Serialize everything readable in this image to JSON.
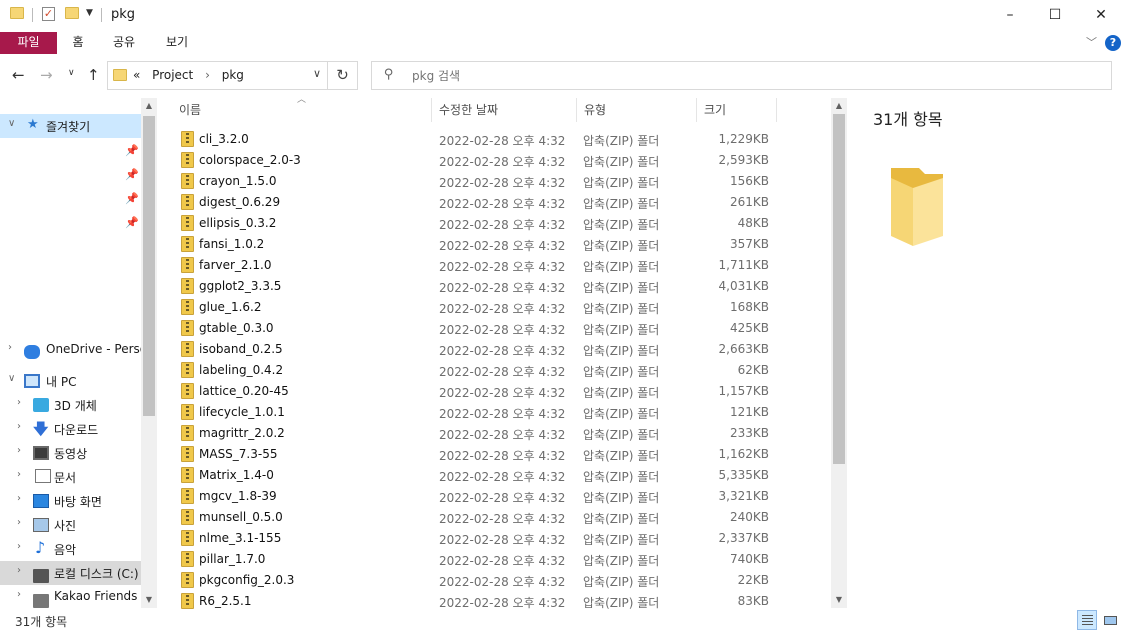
{
  "window": {
    "title": "pkg",
    "controls": {
      "minimize": "–",
      "maximize": "☐",
      "close": "✕"
    }
  },
  "ribbon": {
    "tabs": [
      "파일",
      "홈",
      "공유",
      "보기"
    ],
    "help": "?"
  },
  "address": {
    "overflow": "«",
    "crumbs": [
      "Project",
      "pkg"
    ]
  },
  "search": {
    "placeholder": "pkg 검색"
  },
  "nav": {
    "quick_access": "즐겨찾기",
    "onedrive": "OneDrive - Personal",
    "this_pc": "내 PC",
    "items": [
      {
        "label": "3D 개체",
        "icon": "3d-objects-icon"
      },
      {
        "label": "다운로드",
        "icon": "download-icon"
      },
      {
        "label": "동영상",
        "icon": "video-icon"
      },
      {
        "label": "문서",
        "icon": "document-icon"
      },
      {
        "label": "바탕 화면",
        "icon": "desktop-icon"
      },
      {
        "label": "사진",
        "icon": "picture-icon"
      },
      {
        "label": "음악",
        "icon": "music-icon"
      },
      {
        "label": "로컬 디스크 (C:)",
        "icon": "drive-icon"
      },
      {
        "label": "Kakao Friends (F:)",
        "icon": "drive-icon"
      }
    ]
  },
  "columns": {
    "name": "이름",
    "date": "수정한 날짜",
    "type": "유형",
    "size": "크기"
  },
  "files": [
    {
      "name": "cli_3.2.0",
      "date": "2022-02-28 오후 4:32",
      "type": "압축(ZIP) 폴더",
      "size": "1,229KB"
    },
    {
      "name": "colorspace_2.0-3",
      "date": "2022-02-28 오후 4:32",
      "type": "압축(ZIP) 폴더",
      "size": "2,593KB"
    },
    {
      "name": "crayon_1.5.0",
      "date": "2022-02-28 오후 4:32",
      "type": "압축(ZIP) 폴더",
      "size": "156KB"
    },
    {
      "name": "digest_0.6.29",
      "date": "2022-02-28 오후 4:32",
      "type": "압축(ZIP) 폴더",
      "size": "261KB"
    },
    {
      "name": "ellipsis_0.3.2",
      "date": "2022-02-28 오후 4:32",
      "type": "압축(ZIP) 폴더",
      "size": "48KB"
    },
    {
      "name": "fansi_1.0.2",
      "date": "2022-02-28 오후 4:32",
      "type": "압축(ZIP) 폴더",
      "size": "357KB"
    },
    {
      "name": "farver_2.1.0",
      "date": "2022-02-28 오후 4:32",
      "type": "압축(ZIP) 폴더",
      "size": "1,711KB"
    },
    {
      "name": "ggplot2_3.3.5",
      "date": "2022-02-28 오후 4:32",
      "type": "압축(ZIP) 폴더",
      "size": "4,031KB"
    },
    {
      "name": "glue_1.6.2",
      "date": "2022-02-28 오후 4:32",
      "type": "압축(ZIP) 폴더",
      "size": "168KB"
    },
    {
      "name": "gtable_0.3.0",
      "date": "2022-02-28 오후 4:32",
      "type": "압축(ZIP) 폴더",
      "size": "425KB"
    },
    {
      "name": "isoband_0.2.5",
      "date": "2022-02-28 오후 4:32",
      "type": "압축(ZIP) 폴더",
      "size": "2,663KB"
    },
    {
      "name": "labeling_0.4.2",
      "date": "2022-02-28 오후 4:32",
      "type": "압축(ZIP) 폴더",
      "size": "62KB"
    },
    {
      "name": "lattice_0.20-45",
      "date": "2022-02-28 오후 4:32",
      "type": "압축(ZIP) 폴더",
      "size": "1,157KB"
    },
    {
      "name": "lifecycle_1.0.1",
      "date": "2022-02-28 오후 4:32",
      "type": "압축(ZIP) 폴더",
      "size": "121KB"
    },
    {
      "name": "magrittr_2.0.2",
      "date": "2022-02-28 오후 4:32",
      "type": "압축(ZIP) 폴더",
      "size": "233KB"
    },
    {
      "name": "MASS_7.3-55",
      "date": "2022-02-28 오후 4:32",
      "type": "압축(ZIP) 폴더",
      "size": "1,162KB"
    },
    {
      "name": "Matrix_1.4-0",
      "date": "2022-02-28 오후 4:32",
      "type": "압축(ZIP) 폴더",
      "size": "5,335KB"
    },
    {
      "name": "mgcv_1.8-39",
      "date": "2022-02-28 오후 4:32",
      "type": "압축(ZIP) 폴더",
      "size": "3,321KB"
    },
    {
      "name": "munsell_0.5.0",
      "date": "2022-02-28 오후 4:32",
      "type": "압축(ZIP) 폴더",
      "size": "240KB"
    },
    {
      "name": "nlme_3.1-155",
      "date": "2022-02-28 오후 4:32",
      "type": "압축(ZIP) 폴더",
      "size": "2,337KB"
    },
    {
      "name": "pillar_1.7.0",
      "date": "2022-02-28 오후 4:32",
      "type": "압축(ZIP) 폴더",
      "size": "740KB"
    },
    {
      "name": "pkgconfig_2.0.3",
      "date": "2022-02-28 오후 4:32",
      "type": "압축(ZIP) 폴더",
      "size": "22KB"
    },
    {
      "name": "R6_2.5.1",
      "date": "2022-02-28 오후 4:32",
      "type": "압축(ZIP) 폴더",
      "size": "83KB"
    }
  ],
  "preview": {
    "title": "31개 항목"
  },
  "status": {
    "count": "31개 항목"
  },
  "colors": {
    "file_tab": "#a7194b",
    "selection": "#cce8ff",
    "folder": "#f6d675"
  }
}
